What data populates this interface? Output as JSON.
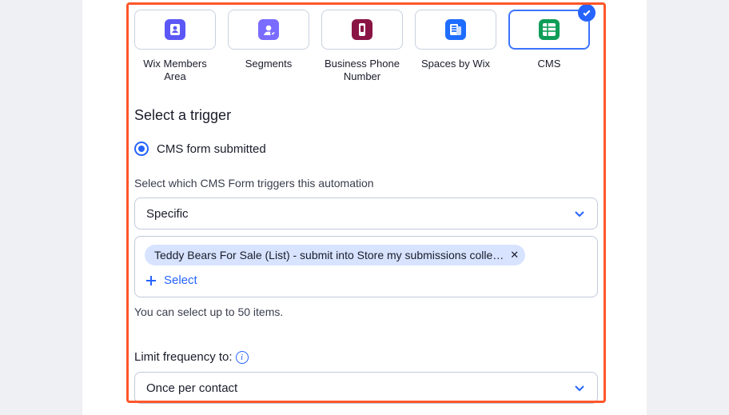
{
  "apps": [
    {
      "label": "Wix Members Area"
    },
    {
      "label": "Segments"
    },
    {
      "label": "Business Phone Number"
    },
    {
      "label": "Spaces by Wix"
    },
    {
      "label": "CMS"
    }
  ],
  "trigger": {
    "section_title": "Select a trigger",
    "radio_label": "CMS form submitted",
    "form_select_label": "Select which CMS Form triggers this automation",
    "form_select_value": "Specific",
    "tag_text": "Teddy Bears For Sale (List) - submit into Store my submissions colle…",
    "add_label": "Select",
    "hint": "You can select up to 50 items."
  },
  "frequency": {
    "label": "Limit frequency to:",
    "value": "Once per contact"
  }
}
